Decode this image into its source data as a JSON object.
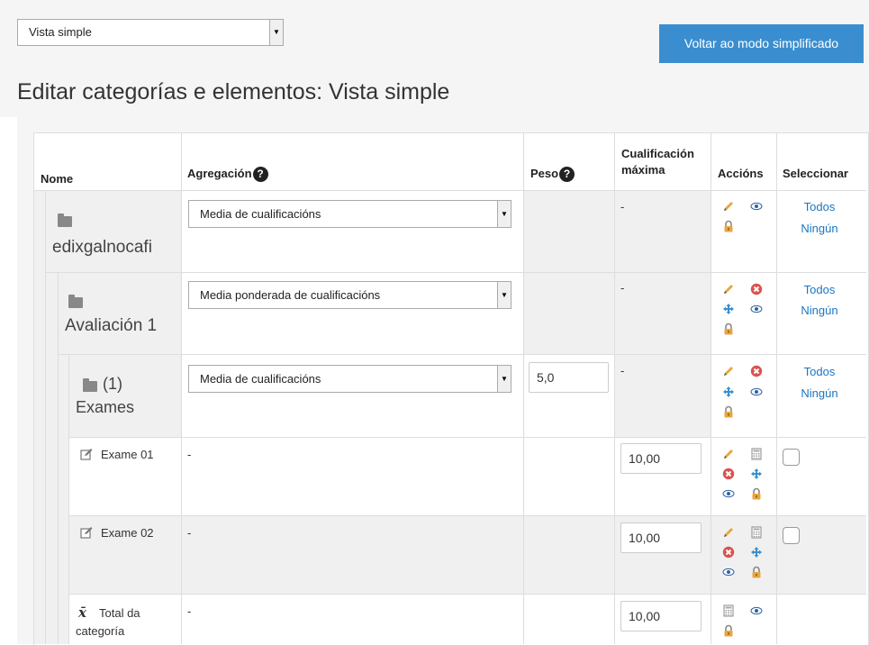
{
  "view_select": {
    "value": "Vista simple"
  },
  "simple_mode_button": "Voltar ao modo simplificado",
  "page_title": "Editar categorías e elementos: Vista simple",
  "table": {
    "headers": {
      "name": "Nome",
      "aggregation": "Agregación",
      "weight": "Peso",
      "max_grade_line1": "Cualificación",
      "max_grade_line2": "máxima",
      "actions": "Accións",
      "select": "Seleccionar"
    },
    "rows": [
      {
        "name": "edixgalnocafi",
        "aggregation": "Media de cualificacións",
        "max_grade": "-",
        "select_all": "Todos",
        "select_none": "Ningún"
      },
      {
        "name": "Avaliación 1",
        "aggregation": "Media ponderada de cualificacións",
        "max_grade": "-",
        "select_all": "Todos",
        "select_none": "Ningún"
      },
      {
        "name_prefix": "(1)",
        "name": "Exames",
        "aggregation": "Media de cualificacións",
        "weight": "5,0",
        "max_grade": "-",
        "select_all": "Todos",
        "select_none": "Ningún"
      },
      {
        "name": "Exame 01",
        "aggregation": "-",
        "max_grade": "10,00"
      },
      {
        "name": "Exame 02",
        "aggregation": "-",
        "max_grade": "10,00"
      },
      {
        "name_line1": "Total da",
        "name_line2": "categoría",
        "aggregation": "-",
        "max_grade": "10,00"
      }
    ]
  },
  "icons": {
    "edit": "pencil-icon",
    "show": "eye-icon",
    "lock": "padlock-icon",
    "delete": "delete-icon",
    "move": "move-icon",
    "calc": "calculator-icon",
    "folder": "folder-icon",
    "grade_item": "edit-item-icon",
    "total": "sigma-x-icon"
  },
  "colors": {
    "primary_button": "#3a8ed0",
    "link": "#1a76c2",
    "delete_icon": "#d9534f",
    "move_icon": "#3a8ed0",
    "edit_icon": "#e8a640",
    "lock_icon": "#e8a640"
  }
}
